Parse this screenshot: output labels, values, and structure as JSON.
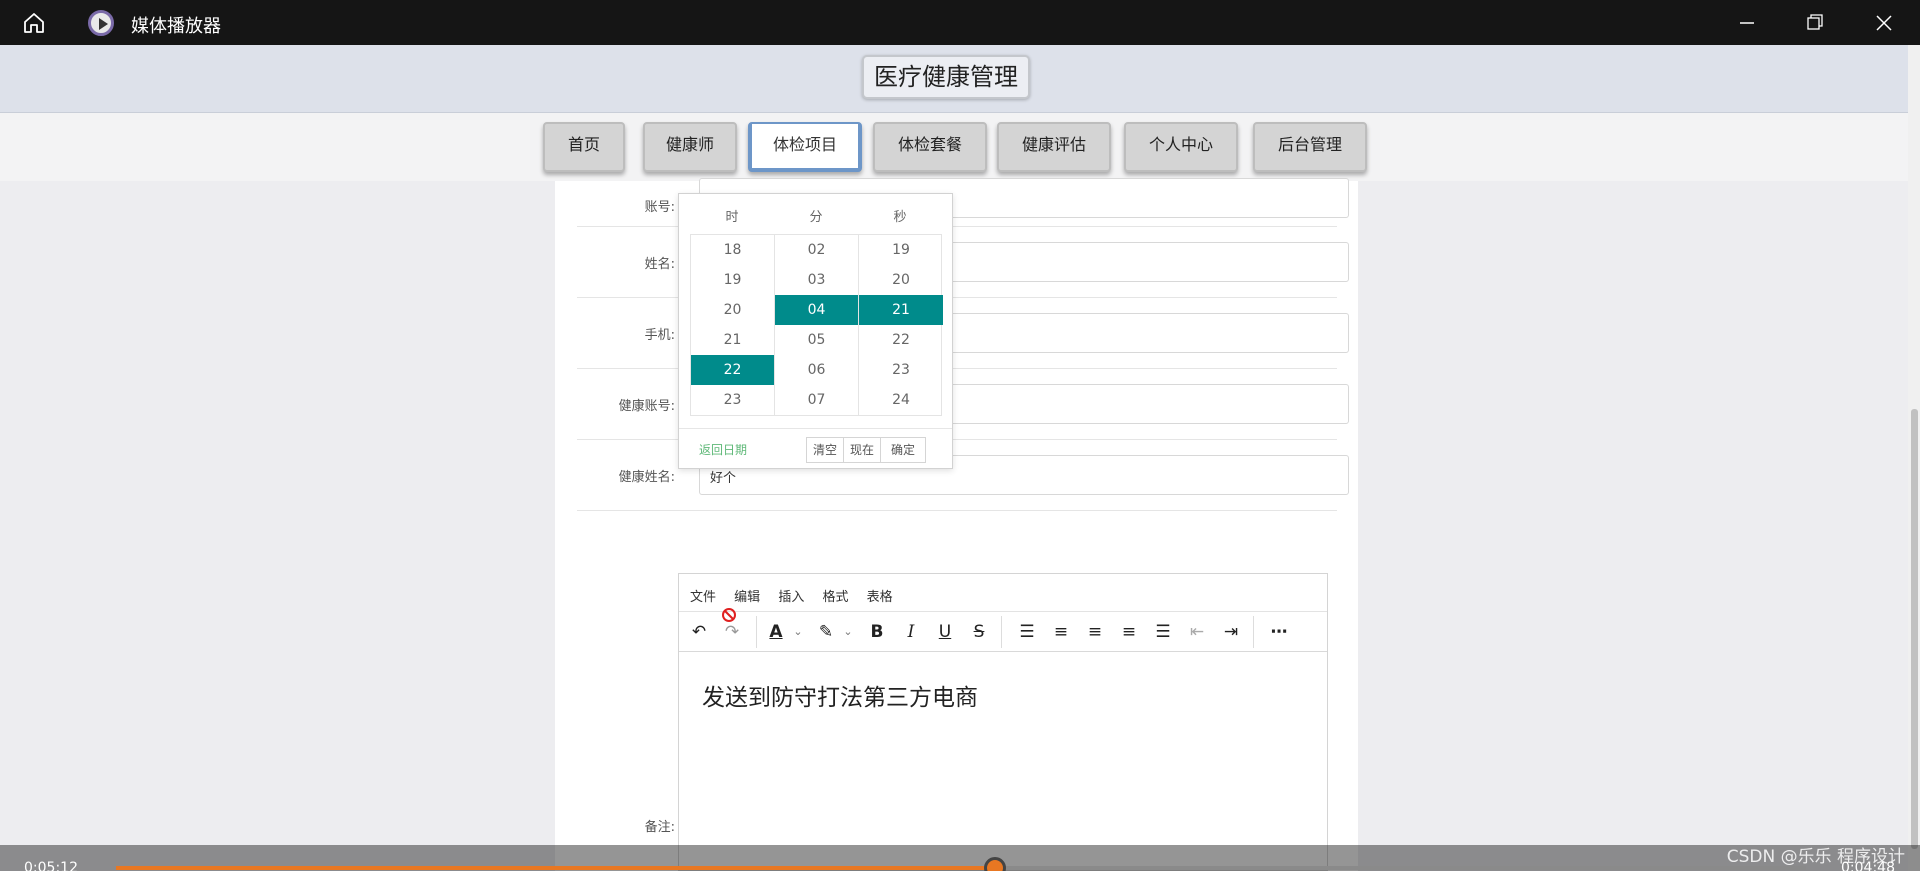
{
  "window": {
    "title": "媒体播放器"
  },
  "site": {
    "title": "医疗健康管理"
  },
  "nav": [
    {
      "label": "首页",
      "active": false
    },
    {
      "label": "健康师",
      "active": false
    },
    {
      "label": "体检项目",
      "active": true
    },
    {
      "label": "体检套餐",
      "active": false
    },
    {
      "label": "健康评估",
      "active": false
    },
    {
      "label": "个人中心",
      "active": false
    },
    {
      "label": "后台管理",
      "active": false
    }
  ],
  "form": {
    "account_label": "账号:",
    "name_label": "姓名:",
    "phone_label": "手机:",
    "health_account_label": "健康账号:",
    "health_name_label": "健康姓名:",
    "health_name_value": "好个",
    "remark_label": "备注:"
  },
  "time_picker": {
    "headers": [
      "时",
      "分",
      "秒"
    ],
    "hours": [
      "18",
      "19",
      "20",
      "21",
      "22",
      "23"
    ],
    "minutes": [
      "02",
      "03",
      "04",
      "05",
      "06",
      "07"
    ],
    "seconds": [
      "19",
      "20",
      "21",
      "22",
      "23",
      "24"
    ],
    "selected_hour": "22",
    "selected_minute": "04",
    "selected_second": "21",
    "back_label": "返回日期",
    "clear_label": "清空",
    "now_label": "现在",
    "confirm_label": "确定",
    "accent_color": "#008b8b"
  },
  "editor": {
    "menu": [
      "文件",
      "编辑",
      "插入",
      "格式",
      "表格"
    ],
    "content": "发送到防守打法第三方电商"
  },
  "player": {
    "elapsed": "0:05:12",
    "remaining": "0:04:48",
    "progress": 0.52,
    "accent_color": "#e87722"
  },
  "watermark": "CSDN @乐乐 程序设计"
}
